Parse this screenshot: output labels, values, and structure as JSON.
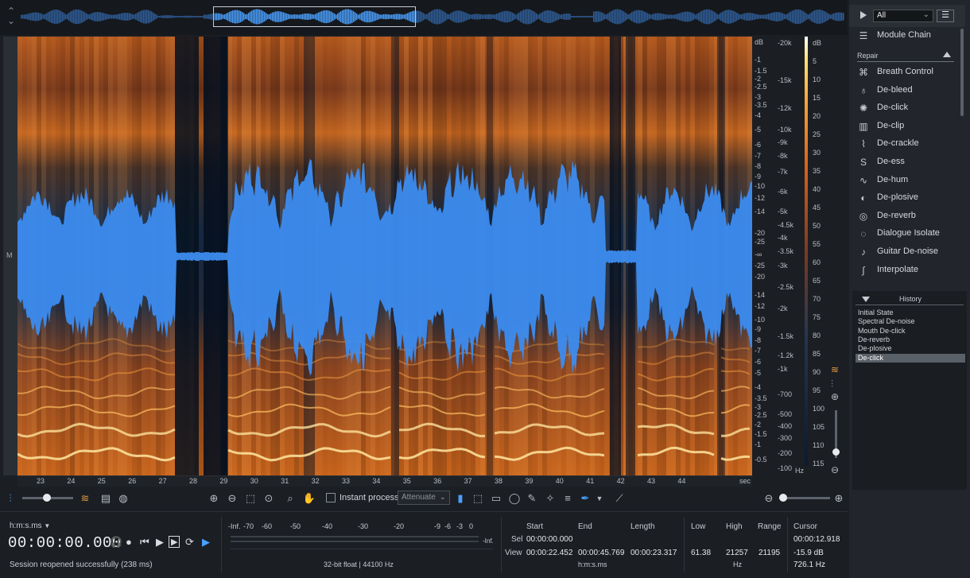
{
  "colors": {
    "accent": "#4aa0ff",
    "waveform": "#3c8cf0",
    "spectrum_hot": "#ffd37a",
    "spectrum_mid": "#d8621a",
    "background": "#1b1e23"
  },
  "channel_label": "M",
  "db_scale": [
    "dB",
    "-1",
    "-1.5",
    "-2",
    "-2.5",
    "-3",
    "-3.5",
    "-4",
    "-5",
    "-6",
    "-7",
    "-8",
    "-9",
    "-10",
    "-12",
    "-14",
    "-20",
    "-25",
    "-∞",
    "-25",
    "-20",
    "-14",
    "-12",
    "-10",
    "-9",
    "-8",
    "-7",
    "-6",
    "-5",
    "-4",
    "-3.5",
    "-3",
    "-2.5",
    "-2",
    "-1.5",
    "-1",
    "-0.5"
  ],
  "hz_scale": [
    "-20k",
    "-15k",
    "-12k",
    "-10k",
    "-9k",
    "-8k",
    "-7k",
    "-6k",
    "-5k",
    "-4.5k",
    "-4k",
    "-3.5k",
    "-3k",
    "-2.5k",
    "-2k",
    "-1.5k",
    "-1.2k",
    "-1k",
    "-700",
    "-500",
    "-400",
    "-300",
    "-200",
    "-100"
  ],
  "hz_unit": "Hz",
  "colorbar_scale": [
    "dB",
    "5",
    "10",
    "15",
    "20",
    "25",
    "30",
    "35",
    "40",
    "45",
    "50",
    "55",
    "60",
    "65",
    "70",
    "75",
    "80",
    "85",
    "90",
    "95",
    "100",
    "105",
    "110",
    "115"
  ],
  "ruler": {
    "ticks": [
      "23",
      "24",
      "25",
      "26",
      "27",
      "28",
      "29",
      "30",
      "31",
      "32",
      "33",
      "34",
      "35",
      "36",
      "37",
      "38",
      "39",
      "40",
      "41",
      "42",
      "43",
      "44"
    ],
    "unit": "sec"
  },
  "toolbar": {
    "instant_process": "Instant process",
    "mode_value": "Attenuate"
  },
  "transport": {
    "format": "h:m:s.ms",
    "time": "00:00:00.000",
    "status": "Session reopened successfully (238 ms)"
  },
  "meter": {
    "labels": [
      "-Inf.",
      "-70",
      "-60",
      "-50",
      "-40",
      "-30",
      "-20",
      "-9",
      "-6",
      "-3",
      "0"
    ],
    "inf": "-Inf.",
    "format_info": "32-bit float | 44100 Hz"
  },
  "selection": {
    "headers": [
      "Start",
      "End",
      "Length"
    ],
    "sel_label": "Sel",
    "view_label": "View",
    "sel_start": "00:00:00.000",
    "view_start": "00:00:22.452",
    "view_end": "00:00:45.769",
    "view_length": "00:00:23.317",
    "unit": "h:m:s.ms"
  },
  "frequency": {
    "headers": [
      "Low",
      "High",
      "Range"
    ],
    "low": "61.38",
    "high": "21257",
    "range": "21195",
    "unit": "Hz"
  },
  "cursor": {
    "header": "Cursor",
    "time": "00:00:12.918",
    "level": "-15.9 dB",
    "freq": "726.1 Hz"
  },
  "panel": {
    "filter_value": "All",
    "module_chain": "Module Chain",
    "group": "Repair",
    "modules": [
      {
        "label": "Breath Control",
        "icon": "lungs-icon"
      },
      {
        "label": "De-bleed",
        "icon": "microphone-icon"
      },
      {
        "label": "De-click",
        "icon": "burst-icon"
      },
      {
        "label": "De-clip",
        "icon": "clip-bars-icon"
      },
      {
        "label": "De-crackle",
        "icon": "crackle-icon"
      },
      {
        "label": "De-ess",
        "icon": "ess-icon"
      },
      {
        "label": "De-hum",
        "icon": "hum-icon"
      },
      {
        "label": "De-plosive",
        "icon": "plosive-icon"
      },
      {
        "label": "De-reverb",
        "icon": "reverb-icon"
      },
      {
        "label": "Dialogue Isolate",
        "icon": "speech-bubble-icon"
      },
      {
        "label": "Guitar De-noise",
        "icon": "guitar-icon"
      },
      {
        "label": "Interpolate",
        "icon": "interpolate-curve-icon"
      }
    ]
  },
  "history": {
    "title": "History",
    "items": [
      "Initial State",
      "Spectral De-noise",
      "Mouth De-click",
      "De-reverb",
      "De-plosive",
      "De-click"
    ],
    "selected_index": 5
  }
}
